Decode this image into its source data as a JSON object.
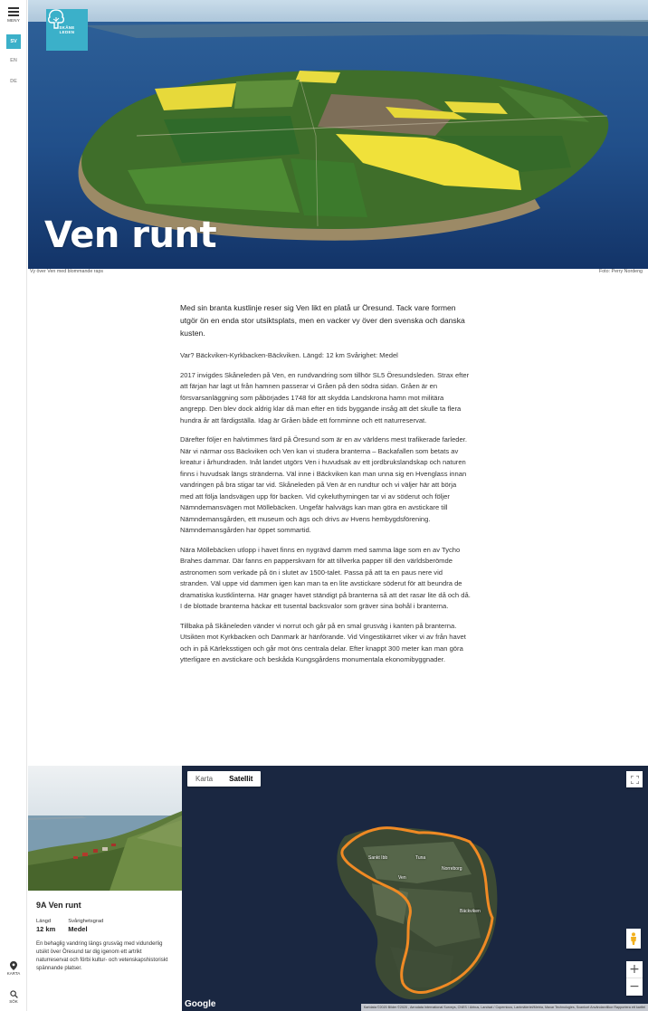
{
  "sidebar": {
    "menu_label": "MENY",
    "languages": [
      "SV",
      "EN",
      "DE"
    ],
    "active_language": "SV",
    "map_label": "KARTA",
    "search_label": "SÖK"
  },
  "hero": {
    "logo_text_line1": "SKÅNE",
    "logo_text_line2": "LEDEN",
    "title": "Ven runt",
    "caption": "Vy över Ven med blommande raps",
    "credit": "Foto: Perry Nordeng"
  },
  "article": {
    "lead": "Med sin branta kustlinje reser sig Ven likt en platå ur Öresund. Tack vare formen utgör ön en enda stor utsiktsplats, men en vacker vy över den svenska och danska kusten.",
    "meta": "Var? Bäckviken-Kyrkbacken-Bäckviken. Längd: 12 km Svårighet: Medel",
    "paragraphs": [
      "2017 invigdes Skåneleden på Ven, en rundvandring som tillhör SL5 Öresundsleden. Strax efter att färjan har lagt ut från hamnen passerar vi Gråen på den södra sidan. Gråen är en försvarsanläggning som påbörjades 1748 för att skydda Landskrona hamn mot militära angrepp. Den blev dock aldrig klar då man efter en tids byggande insåg att det skulle ta flera hundra år att färdigställa. Idag är Gråen både ett fornminne och ett naturreservat.",
      "Därefter följer en halvtimmes färd på Öresund som är en av världens mest trafikerade farleder. När vi närmar oss Bäckviken och Ven kan vi studera branterna – Backafallen som betats av kreatur i århundraden. Inåt landet utgörs Ven i huvudsak av ett jordbrukslandskap och naturen finns i huvudsak längs stränderna. Väl inne i Bäckviken kan man unna sig en Hvenglass innan vandringen på bra stigar tar vid. Skåneleden på Ven är en rundtur och vi väljer här att börja med att följa landsvägen upp för backen. Vid cykeluthyrningen tar vi av söderut och följer Nämndemansvägen mot Möllebäcken. Ungefär halvvägs kan man göra en avstickare till Nämndemansgården, ett museum och ägs och drivs av Hvens hembygdsförening. Nämndemansgården har öppet sommartid.",
      "Nära Möllebäcken utlopp i havet finns en nygrävd damm med samma läge som en av Tycho Brahes dammar. Där fanns en papperskvarn för att tillverka papper till den världsberömde astronomen som verkade på ön i slutet av 1500-talet. Passa på att ta en paus nere vid stranden. Väl uppe vid dammen igen kan man ta en lite avstickare söderut för att beundra de dramatiska kustklinterna. Här gnager havet ständigt på branterna så att det rasar lite då och då. I de blottade branterna häckar ett tusental backsvalor som gräver sina bohål i branterna.",
      "Tillbaka på Skåneleden vänder vi norrut och går på en smal grusväg i kanten på branterna. Utsikten mot Kyrkbacken och Danmark är hänförande. Vid Vingestikärret viker vi av från havet och in på Kärleksstigen och går mot öns centrala delar. Efter knappt 300 meter kan man göra ytterligare en avstickare och beskåda Kungsgårdens monumentala ekonomibyggnader."
    ]
  },
  "route": {
    "title": "9A Ven runt",
    "length_label": "Längd",
    "length_value": "12 km",
    "difficulty_label": "Svårighetsgrad",
    "difficulty_value": "Medel",
    "description": "En behaglig vandring längs grusväg med vidunderlig utsikt över Öresund tar dig igenom ett artrikt naturreservat och förbi kultur- och vetenskapshistoriskt spännande platser."
  },
  "map": {
    "type_map": "Karta",
    "type_satellite": "Satellit",
    "selected_type": "Satellit",
    "places": [
      "Sankt Ibb",
      "Tuna",
      "Norreborg",
      "Ven",
      "Bäckviken"
    ],
    "google": "Google",
    "attribution": "Kartdata ©2020 Bilder ©2020 , Aerodata International Surveys, CNES / Airbus, Landsat / Copernicus, Lantmäteriet/Metria, Maxar Technologies, Scankort   Användarvillkor   Rapportera ett kartfel",
    "route_color": "#f08a24"
  },
  "colors": {
    "accent": "#3bb0c9"
  }
}
